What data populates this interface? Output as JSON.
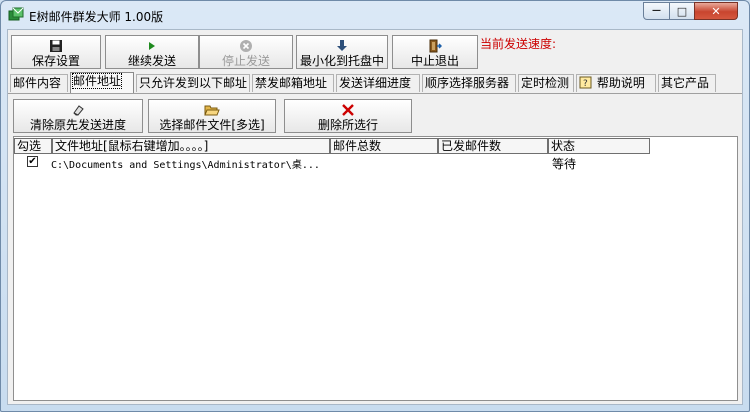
{
  "window": {
    "title": "E树邮件群发大师 1.00版",
    "min_symbol": "—",
    "max_symbol": "□",
    "close_symbol": "✕"
  },
  "toolbar": {
    "save": "保存设置",
    "continue": "继续发送",
    "stop": "停止发送",
    "minimize_tray": "最小化到托盘中",
    "exit": "中止退出",
    "speed_label": "当前发送速度:"
  },
  "tabs": [
    {
      "label": "邮件内容"
    },
    {
      "label": "邮件地址"
    },
    {
      "label": "只允许发到以下邮址"
    },
    {
      "label": "禁发邮箱地址"
    },
    {
      "label": "发送详细进度"
    },
    {
      "label": "顺序选择服务器"
    },
    {
      "label": "定时检测"
    },
    {
      "label": "帮助说明"
    },
    {
      "label": "其它产品"
    }
  ],
  "actions": {
    "clear": "清除原先发送进度",
    "select_files": "选择邮件文件[多选]",
    "delete": "删除所选行"
  },
  "table": {
    "columns": [
      "勾选",
      "文件地址[鼠标右键增加。。。。]",
      "邮件总数",
      "已发邮件数",
      "状态"
    ],
    "rows": [
      {
        "checked": "✔",
        "path": "C:\\Documents and Settings\\Administrator\\桌...",
        "total": "",
        "sent": "",
        "status": "等待"
      }
    ]
  },
  "colors": {
    "speed_label": "#cc0000",
    "delete_icon": "#cc0000",
    "continue_icon": "#1e8a1e"
  }
}
